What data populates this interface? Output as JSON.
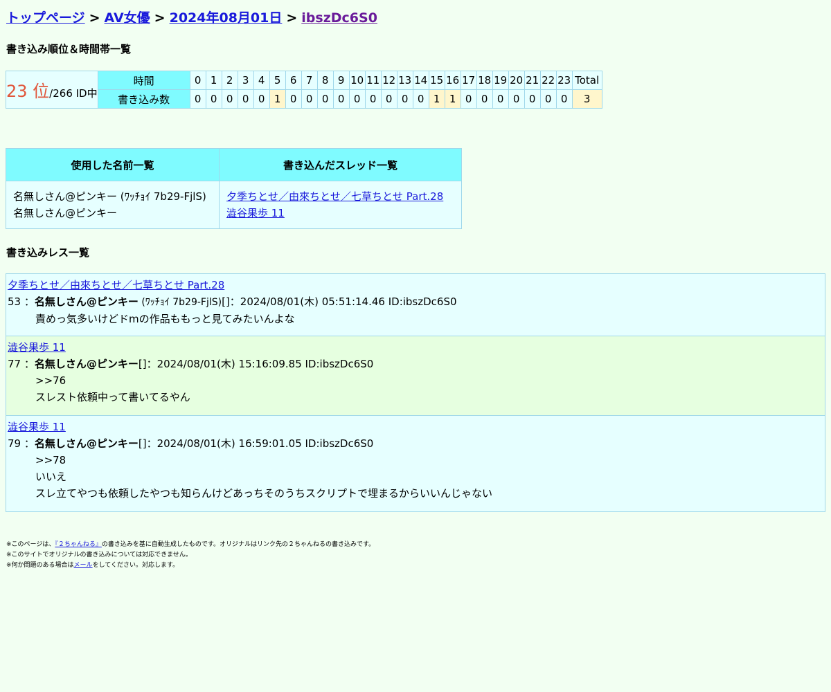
{
  "breadcrumb": {
    "top": "トップページ",
    "category": "AV女優",
    "date": "2024年08月01日",
    "id": "ibszDc6S0",
    "separator": ">"
  },
  "rank_section": {
    "title": "書き込み順位＆時間帯一覧",
    "rank": "23 位",
    "rank_total": "/266 ID中",
    "time_label": "時間",
    "count_label": "書き込み数",
    "hours": [
      "0",
      "1",
      "2",
      "3",
      "4",
      "5",
      "6",
      "7",
      "8",
      "9",
      "10",
      "11",
      "12",
      "13",
      "14",
      "15",
      "16",
      "17",
      "18",
      "19",
      "20",
      "21",
      "22",
      "23"
    ],
    "counts": [
      "0",
      "0",
      "0",
      "0",
      "0",
      "1",
      "0",
      "0",
      "0",
      "0",
      "0",
      "0",
      "0",
      "0",
      "0",
      "1",
      "1",
      "0",
      "0",
      "0",
      "0",
      "0",
      "0",
      "0"
    ],
    "total_label": "Total",
    "total": "3",
    "highlight_color": "#fff6cc",
    "header_color": "#7ffbff"
  },
  "info_table": {
    "names_header": "使用した名前一覧",
    "threads_header": "書き込んだスレッド一覧",
    "names": [
      "名無しさん@ピンキー (ﾜｯﾁｮｲ 7b29-FjlS)",
      "名無しさん@ピンキー"
    ],
    "threads": [
      "夕季ちとせ／由來ちとせ／七草ちとせ Part.28",
      "澁谷果歩 11"
    ]
  },
  "posts_section": {
    "title": "書き込みレス一覧",
    "posts": [
      {
        "thread": "夕季ちとせ／由來ちとせ／七草ちとせ Part.28",
        "num": "53",
        "name": "名無しさん@ピンキー",
        "trip": " (ﾜｯﾁｮｲ 7b29-FjlS)",
        "meta": "[]：2024/08/01(木) 05:51:14.46 ID:ibszDc6S0",
        "body": [
          "責めっ気多いけどドmの作品ももっと見てみたいんよな"
        ]
      },
      {
        "thread": "澁谷果歩 11",
        "num": "77",
        "name": "名無しさん@ピンキー",
        "trip": "",
        "meta": "[]：2024/08/01(木) 15:16:09.85 ID:ibszDc6S0",
        "body": [
          ">>76",
          "スレスト依頼中って書いてるやん"
        ]
      },
      {
        "thread": "澁谷果歩 11",
        "num": "79",
        "name": "名無しさん@ピンキー",
        "trip": "",
        "meta": "[]：2024/08/01(木) 16:59:01.05 ID:ibszDc6S0",
        "body": [
          ">>78",
          "いいえ",
          "スレ立てやつも依頼したやつも知らんけどあっちそのうちスクリプトで埋まるからいいんじゃない"
        ]
      }
    ]
  },
  "footer": {
    "line1_pre": "※このページは、",
    "line1_link": "『２ちゃんねる』",
    "line1_post": "の書き込みを基に自動生成したものです。オリジナルはリンク先の２ちゃんねるの書き込みです。",
    "line2": "※このサイトでオリジナルの書き込みについては対応できません。",
    "line3_pre": "※何か問題のある場合は",
    "line3_link": "メール",
    "line3_post": "をしてください。対応します。"
  }
}
